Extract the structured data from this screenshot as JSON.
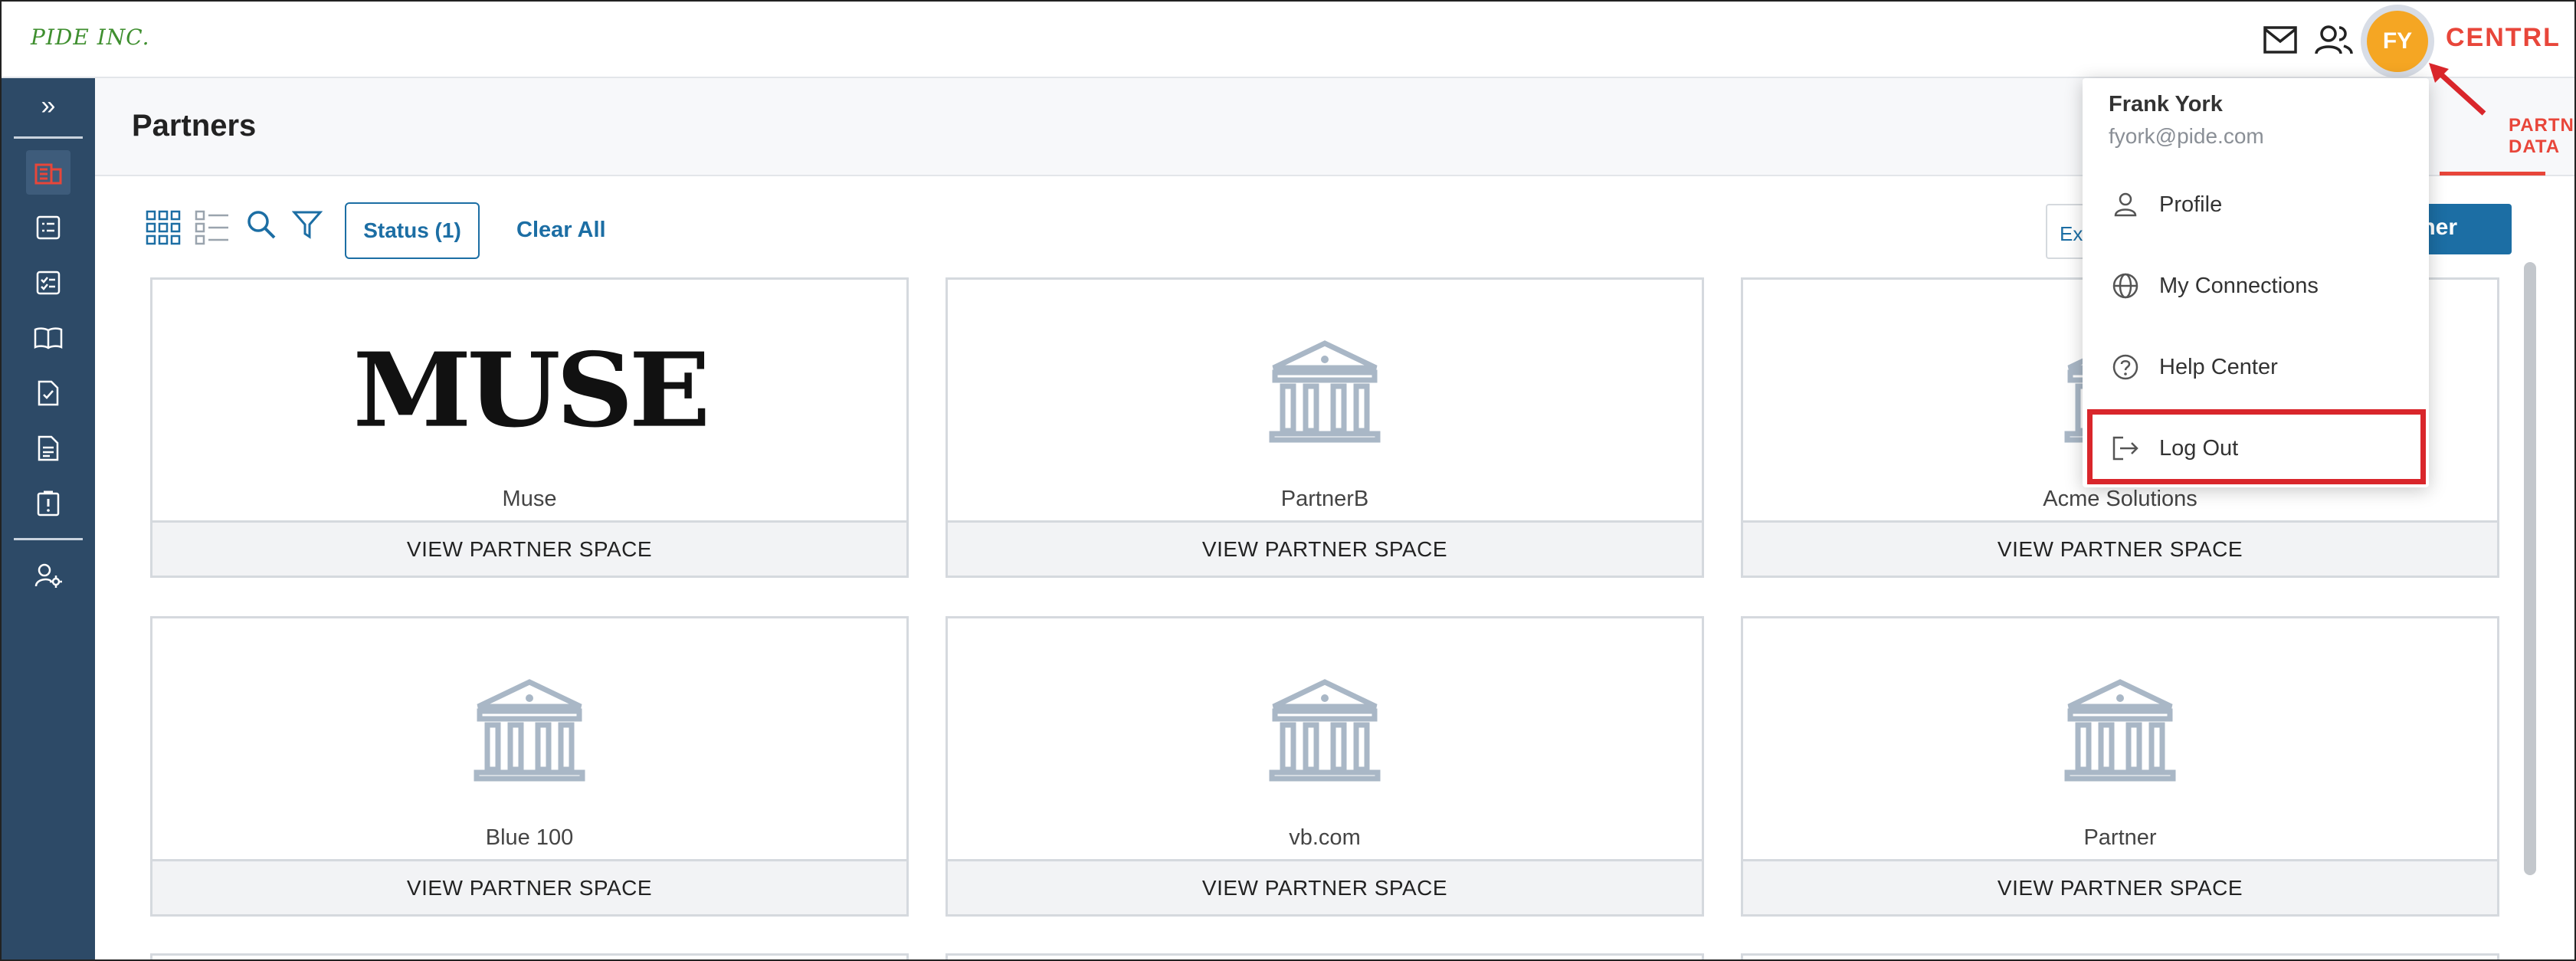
{
  "topbar": {
    "brand": "PIDE INC.",
    "avatar_initials": "FY",
    "product": "CENTRL",
    "icons": [
      "mail-icon",
      "contacts-icon"
    ]
  },
  "sidebar": {
    "toggle": "»",
    "items": [
      "partners-icon",
      "checklist-icon",
      "tasks-icon",
      "book-icon",
      "doc-check-icon",
      "document-icon",
      "alert-doc-icon",
      "user-settings-icon"
    ]
  },
  "header": {
    "title": "Partners",
    "tab_label": "PARTNER DATA"
  },
  "toolbar": {
    "status_filter": "Status (1)",
    "clear_all": "Clear All",
    "export_label": "Ex",
    "add_partner_label": "Partner"
  },
  "cards": [
    {
      "name": "Muse",
      "logo": "muse",
      "logo_text": "MUSE",
      "button": "VIEW PARTNER SPACE"
    },
    {
      "name": "PartnerB",
      "logo": "building",
      "button": "VIEW PARTNER SPACE"
    },
    {
      "name": "Acme Solutions",
      "logo": "building",
      "button": "VIEW PARTNER SPACE"
    },
    {
      "name": "Blue 100",
      "logo": "building",
      "button": "VIEW PARTNER SPACE"
    },
    {
      "name": "vb.com",
      "logo": "building",
      "button": "VIEW PARTNER SPACE"
    },
    {
      "name": "Partner",
      "logo": "building",
      "button": "VIEW PARTNER SPACE"
    }
  ],
  "user_menu": {
    "name": "Frank York",
    "email": "fyork@pide.com",
    "items": [
      {
        "label": "Profile",
        "icon": "person-icon"
      },
      {
        "label": "My Connections",
        "icon": "globe-icon"
      },
      {
        "label": "Help Center",
        "icon": "help-icon"
      },
      {
        "label": "Log Out",
        "icon": "logout-icon"
      }
    ]
  },
  "colors": {
    "sidebar": "#2d4a67",
    "accent": "#1c6ea4",
    "brand_red": "#e8463a",
    "avatar": "#f5a623",
    "highlight": "#d9262b"
  }
}
